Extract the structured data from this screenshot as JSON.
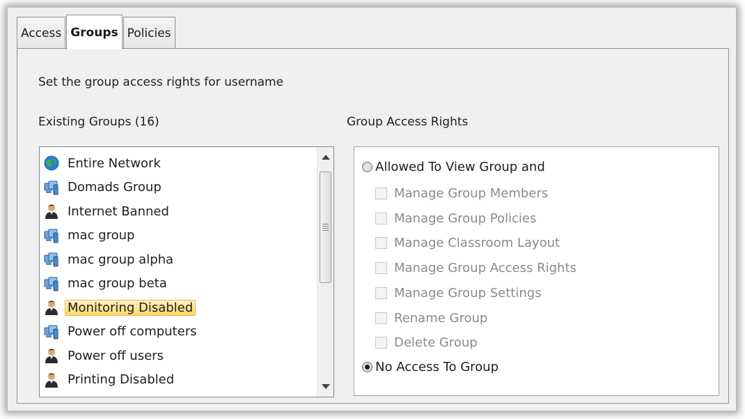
{
  "tabs": [
    {
      "label": "Access"
    },
    {
      "label": "Groups"
    },
    {
      "label": "Policies"
    }
  ],
  "description": "Set the group access rights for username",
  "existing_groups_label": "Existing Groups (16)",
  "group_access_rights_label": "Group Access Rights",
  "groups": [
    {
      "label": "Entire Network",
      "icon": "globe-icon"
    },
    {
      "label": "Domads Group",
      "icon": "computer-group-icon"
    },
    {
      "label": "Internet Banned",
      "icon": "user-group-icon"
    },
    {
      "label": "mac group",
      "icon": "computer-group-icon"
    },
    {
      "label": "mac group alpha",
      "icon": "computer-group-icon"
    },
    {
      "label": "mac group beta",
      "icon": "computer-group-icon"
    },
    {
      "label": "Monitoring Disabled",
      "icon": "user-group-icon",
      "selected": true
    },
    {
      "label": "Power off computers",
      "icon": "computer-group-icon"
    },
    {
      "label": "Power off users",
      "icon": "user-group-icon"
    },
    {
      "label": "Printing Disabled",
      "icon": "user-group-icon"
    }
  ],
  "rights": {
    "allowed_label": "Allowed To View Group and",
    "permissions": [
      "Manage Group Members",
      "Manage Group Policies",
      "Manage Classroom Layout",
      "Manage Group Access Rights",
      "Manage Group Settings",
      "Rename Group",
      "Delete Group"
    ],
    "no_access_label": "No Access To Group",
    "selected": "no_access"
  },
  "colors": {
    "selection_top": "#fff2c5",
    "selection_bottom": "#fcd966",
    "disabled_text": "#8a8a8a"
  }
}
